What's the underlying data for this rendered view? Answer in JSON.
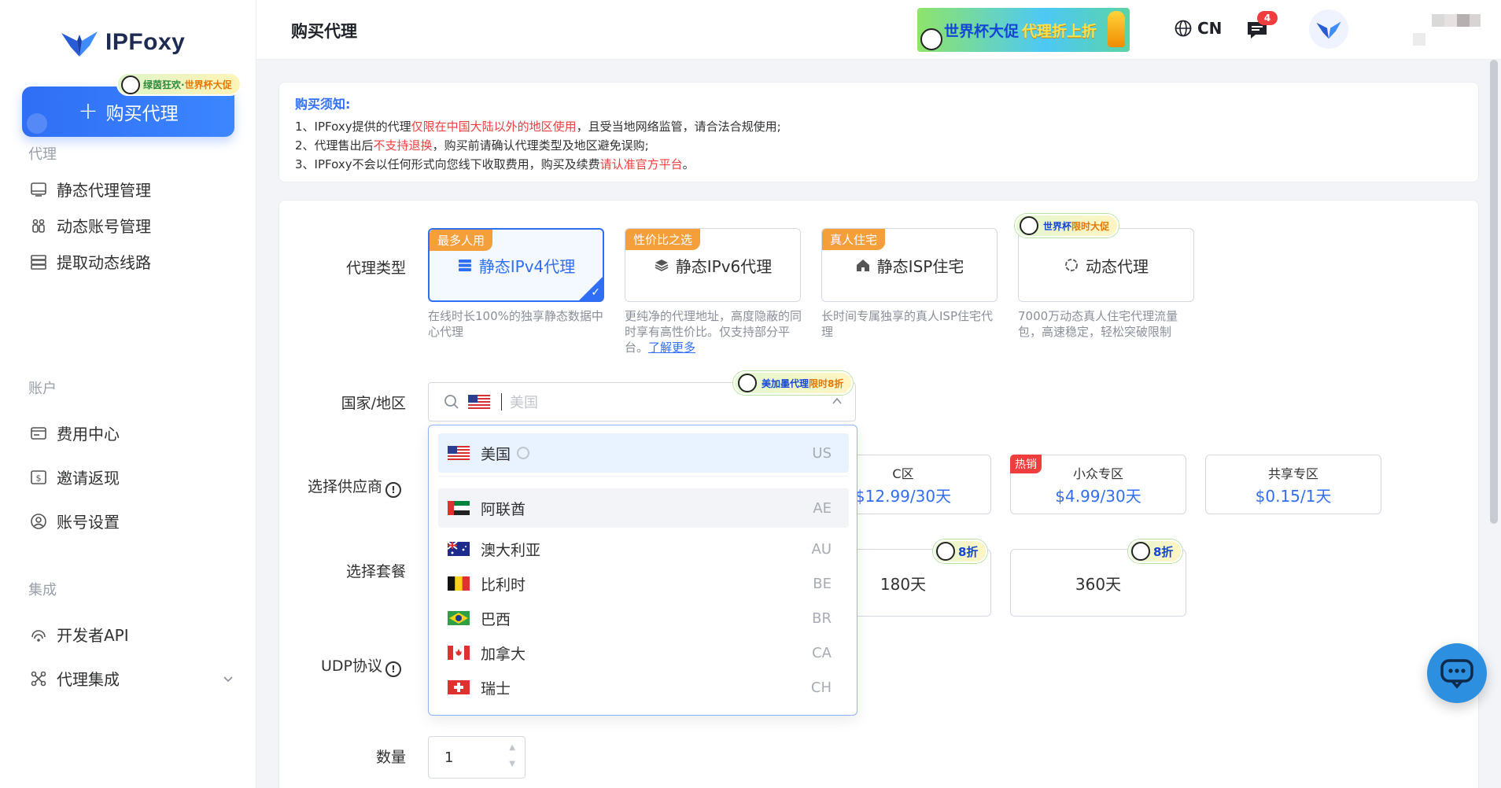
{
  "sidebar": {
    "logo_text": "IPFoxy",
    "buy_button_label": "购买代理",
    "buy_badge_left": "绿茵狂欢·",
    "buy_badge_right": "世界杯大促",
    "sections": [
      {
        "label": "代理"
      },
      {
        "label": "账户"
      },
      {
        "label": "集成"
      }
    ],
    "items": [
      {
        "label": "静态代理管理",
        "icon": "monitor-icon"
      },
      {
        "label": "动态账号管理",
        "icon": "accounts-icon"
      },
      {
        "label": "提取动态线路",
        "icon": "server-icon"
      },
      {
        "label": "费用中心",
        "icon": "wallet-icon"
      },
      {
        "label": "邀请返现",
        "icon": "dollar-icon"
      },
      {
        "label": "账号设置",
        "icon": "user-icon"
      },
      {
        "label": "开发者API",
        "icon": "api-icon"
      },
      {
        "label": "代理集成",
        "icon": "integration-icon"
      }
    ]
  },
  "header": {
    "title": "购买代理",
    "promo_text": "世界杯大促",
    "promo_accent": "代理折上折",
    "lang": "CN",
    "msg_count": "4"
  },
  "notice": {
    "title": "购买须知:",
    "lines": [
      {
        "pre": "1、IPFoxy提供的代理",
        "red": "仅限在中国大陆以外的地区使用",
        "post": "，且受当地网络监管，请合法合规使用;"
      },
      {
        "pre": "2、代理售出后",
        "red": "不支持退换",
        "post": "，购买前请确认代理类型及地区避免误购;"
      },
      {
        "pre": "3、IPFoxy不会以任何形式向您线下收取费用，购买及续费",
        "red": "请认准官方平台",
        "post": "。"
      }
    ]
  },
  "form": {
    "proxy_type_label": "代理类型",
    "country_label": "国家/地区",
    "supplier_label": "选择供应商",
    "package_label": "选择套餐",
    "udp_label": "UDP协议",
    "qty_label": "数量",
    "proxy_types": [
      {
        "tag": "最多人用",
        "label": "静态IPv4代理",
        "desc": "在线时长100%的独享静态数据中心代理",
        "active": true
      },
      {
        "tag": "性价比之选",
        "label": "静态IPv6代理",
        "desc": "更纯净的代理地址，高度隐蔽的同时享有高性价比。仅支持部分平台。",
        "link": "了解更多",
        "active": false
      },
      {
        "tag": "真人住宅",
        "label": "静态ISP住宅",
        "desc": "长时间专属独享的真人ISP住宅代理",
        "active": false
      },
      {
        "tag": "",
        "label": "动态代理",
        "desc": "7000万动态真人住宅代理流量包，高速稳定，轻松突破限制",
        "active": false
      }
    ],
    "wc_tag_left": "世界杯",
    "wc_tag_right": "限时大促",
    "country_promo_left": "美加墨代理",
    "country_promo_right": "限时8折",
    "country_placeholder": "美国",
    "countries": [
      {
        "name": "美国",
        "code": "US",
        "state": "selected"
      },
      {
        "name": "阿联酋",
        "code": "AE",
        "state": "hover"
      },
      {
        "name": "澳大利亚",
        "code": "AU",
        "state": ""
      },
      {
        "name": "比利时",
        "code": "BE",
        "state": ""
      },
      {
        "name": "巴西",
        "code": "BR",
        "state": ""
      },
      {
        "name": "加拿大",
        "code": "CA",
        "state": ""
      },
      {
        "name": "瑞士",
        "code": "CH",
        "state": ""
      }
    ],
    "suppliers": [
      {
        "name": "C区",
        "price": "$12.99/30天",
        "hot": ""
      },
      {
        "name": "小众专区",
        "price": "$4.99/30天",
        "hot": "热销"
      },
      {
        "name": "共享专区",
        "price": "$0.15/1天",
        "hot": ""
      }
    ],
    "packages": [
      {
        "label": "180天",
        "discount": "8折"
      },
      {
        "label": "360天",
        "discount": "8折"
      }
    ],
    "quantity": "1"
  },
  "colors": {
    "primary": "#2f6ef5",
    "danger": "#f03e3e",
    "tag_orange": "#f59f3a",
    "tag_blue": "#5b9bff"
  }
}
